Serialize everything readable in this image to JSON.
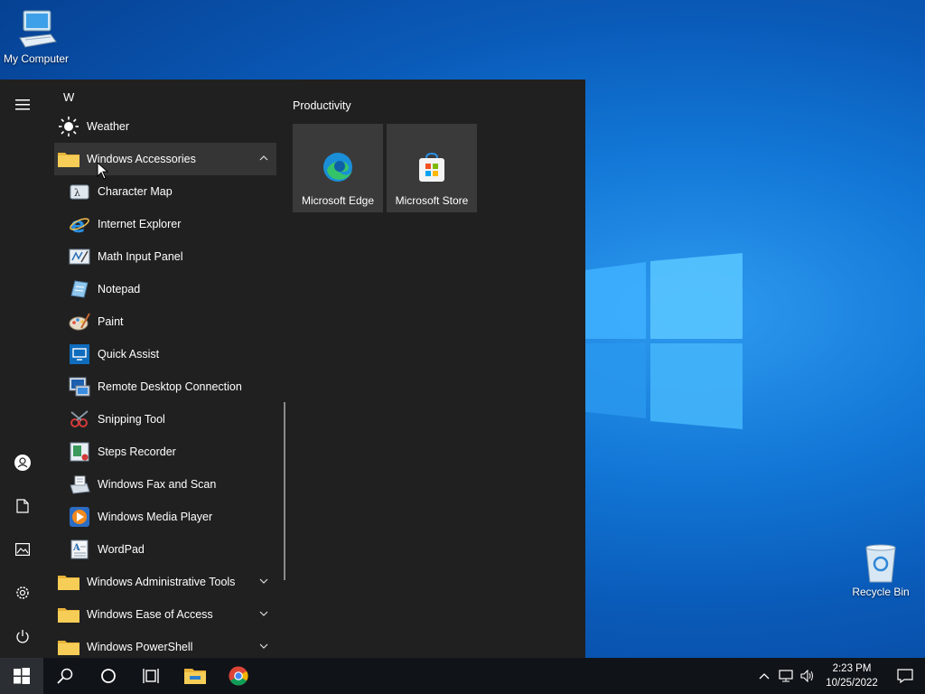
{
  "desktop": {
    "icons": [
      {
        "label": "My Computer"
      },
      {
        "label": "Recycle Bin"
      }
    ]
  },
  "start_menu": {
    "rail": [
      "menu-icon",
      "user-icon",
      "documents-icon",
      "pictures-icon",
      "settings-icon",
      "power-icon"
    ],
    "section_letter": "W",
    "apps": [
      {
        "label": "Weather",
        "icon": "weather-icon"
      },
      {
        "label": "Windows Accessories",
        "icon": "folder-icon",
        "expanded": true
      },
      {
        "label": "Character Map",
        "icon": "character-map-icon"
      },
      {
        "label": "Internet Explorer",
        "icon": "internet-explorer-icon"
      },
      {
        "label": "Math Input Panel",
        "icon": "math-input-panel-icon"
      },
      {
        "label": "Notepad",
        "icon": "notepad-icon"
      },
      {
        "label": "Paint",
        "icon": "paint-icon"
      },
      {
        "label": "Quick Assist",
        "icon": "quick-assist-icon"
      },
      {
        "label": "Remote Desktop Connection",
        "icon": "remote-desktop-icon"
      },
      {
        "label": "Snipping Tool",
        "icon": "snipping-tool-icon"
      },
      {
        "label": "Steps Recorder",
        "icon": "steps-recorder-icon"
      },
      {
        "label": "Windows Fax and Scan",
        "icon": "fax-scan-icon"
      },
      {
        "label": "Windows Media Player",
        "icon": "media-player-icon"
      },
      {
        "label": "WordPad",
        "icon": "wordpad-icon"
      },
      {
        "label": "Windows Administrative Tools",
        "icon": "folder-icon",
        "expanded": false
      },
      {
        "label": "Windows Ease of Access",
        "icon": "folder-icon",
        "expanded": false
      },
      {
        "label": "Windows PowerShell",
        "icon": "folder-icon",
        "expanded": false
      }
    ],
    "tiles_group": "Productivity",
    "tiles": [
      {
        "label": "Microsoft Edge",
        "icon": "edge-icon"
      },
      {
        "label": "Microsoft Store",
        "icon": "store-icon"
      }
    ]
  },
  "taskbar": {
    "buttons": [
      "start-icon",
      "search-icon",
      "cortana-icon",
      "task-view-icon",
      "file-explorer-icon",
      "chrome-icon"
    ],
    "tray": [
      "chevron-up-icon",
      "network-icon",
      "volume-icon"
    ],
    "time": "2:23 PM",
    "date": "10/25/2022"
  },
  "colors": {
    "menu_bg": "#202020",
    "tile_bg": "#3a3a3a",
    "taskbar_bg": "#101418",
    "folder": "#f2c14e"
  }
}
